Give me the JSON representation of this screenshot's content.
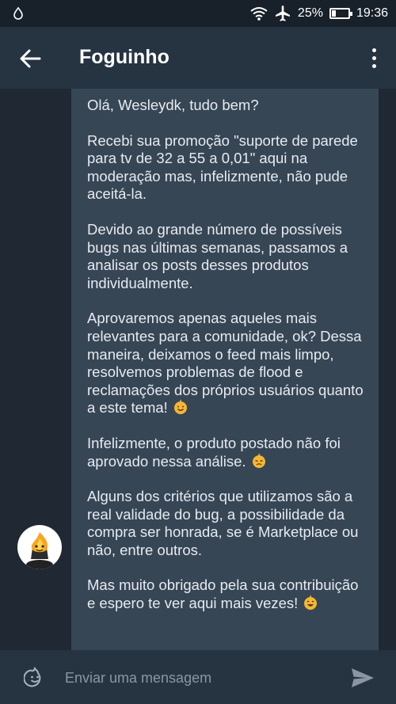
{
  "status_bar": {
    "battery": "25%",
    "battery_level": 0.25,
    "time": "19:36"
  },
  "header": {
    "title": "Foguinho"
  },
  "message": {
    "paragraphs": [
      "Olá, Wesleydk, tudo bem?",
      "Recebi sua promoção \"suporte de parede para tv de 32 a 55 a 0,01\" aqui na moderação mas, infelizmente, não pude aceitá-la.",
      "Devido ao grande número de possíveis bugs nas últimas semanas, passamos a analisar os posts desses produtos individualmente.",
      "Aprovaremos apenas aqueles mais relevantes para a comunidade, ok? Dessa maneira, deixamos o feed mais limpo, resolvemos problemas de flood e reclamações dos próprios usuários quanto a este tema!",
      "Infelizmente, o produto postado não foi aprovado nessa análise.",
      "Alguns dos critérios que utilizamos são a real validade do bug, a possibilidade da compra ser honrada, se é Marketplace ou não, entre outros.",
      "Mas muito obrigado pela sua contribuição e espero te ver aqui mais vezes!"
    ]
  },
  "composer": {
    "placeholder": "Enviar uma mensagem"
  },
  "icons": {
    "status_left": "water-drop-icon",
    "wifi": "wifi-icon",
    "airplane": "airplane-icon",
    "battery": "battery-icon",
    "back": "back-arrow-icon",
    "menu": "more-vert-icon",
    "emoji_picker": "emoji-icon",
    "send": "send-icon",
    "avatar": "flame-avatar-icon"
  },
  "colors": {
    "background": "#1f2833",
    "app_bar": "#263341",
    "bubble": "#374655",
    "text": "#e6ebf0",
    "emoji": "#f5b733"
  }
}
